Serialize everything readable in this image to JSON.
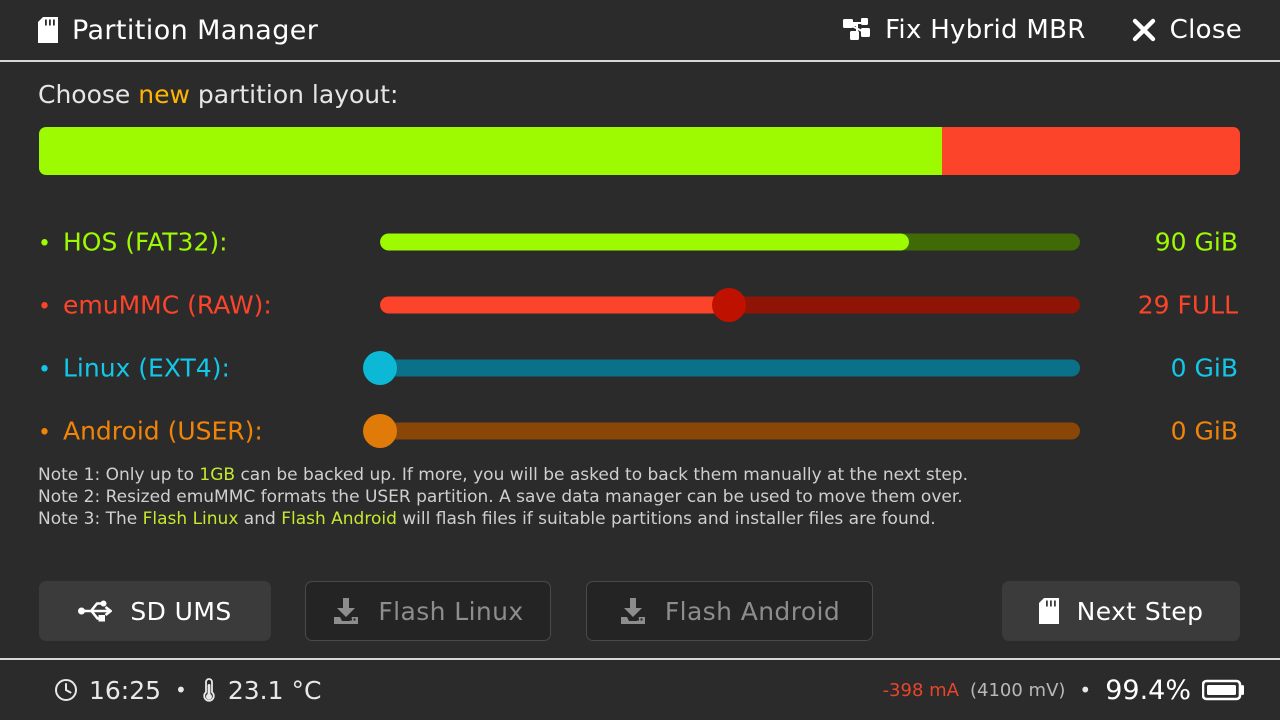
{
  "header": {
    "title": "Partition Manager",
    "title_icon": "sd-card-icon",
    "actions": [
      {
        "label": "Fix Hybrid MBR",
        "icon": "partition-tree-icon"
      },
      {
        "label": "Close",
        "icon": "close-x-icon"
      }
    ]
  },
  "prompt": {
    "prefix": "Choose ",
    "highlight": "new",
    "suffix": " partition layout:"
  },
  "layout_bar": {
    "segments": [
      {
        "name": "hos",
        "color": "#9dfa00",
        "percent": 75.2
      },
      {
        "name": "emummc",
        "color": "#fb4429",
        "percent": 24.8
      }
    ]
  },
  "partitions": [
    {
      "name": "hos",
      "label": "HOS (FAT32):",
      "value": "90 GiB",
      "color": "#9dfa00",
      "track_color": "#3f6a06",
      "fill_percent": 75.5,
      "knob": false,
      "knob_color": "#9dfa00"
    },
    {
      "name": "emummc",
      "label": "emuMMC (RAW):",
      "value": "29 FULL",
      "color": "#fb4429",
      "track_color": "#8f1405",
      "fill_percent": 49.8,
      "knob": true,
      "knob_color": "#bf1100"
    },
    {
      "name": "linux",
      "label": "Linux (EXT4):",
      "value": "0 GiB",
      "color": "#12c7e8",
      "track_color": "#0a7188",
      "fill_percent": 0,
      "knob": true,
      "knob_color": "#0cb8d6"
    },
    {
      "name": "android",
      "label": "Android (USER):",
      "value": "0 GiB",
      "color": "#f08409",
      "track_color": "#8a4606",
      "fill_percent": 0,
      "knob": true,
      "knob_color": "#e07b0a"
    }
  ],
  "notes": [
    {
      "parts": [
        {
          "t": "Note 1: Only up to ",
          "hl": false
        },
        {
          "t": "1GB",
          "hl": true
        },
        {
          "t": " can be backed up. If more, you will be asked to back them manually at the next step.",
          "hl": false
        }
      ]
    },
    {
      "parts": [
        {
          "t": "Note 2: Resized emuMMC formats the USER partition. A save data manager can be used to move them over.",
          "hl": false
        }
      ]
    },
    {
      "parts": [
        {
          "t": "Note 3: The ",
          "hl": false
        },
        {
          "t": "Flash Linux",
          "hl": true
        },
        {
          "t": " and ",
          "hl": false
        },
        {
          "t": "Flash Android",
          "hl": true
        },
        {
          "t": " will flash files if suitable partitions and installer files are found.",
          "hl": false
        }
      ]
    }
  ],
  "buttons": [
    {
      "name": "sd-ums",
      "label": "SD UMS",
      "icon": "usb-icon",
      "enabled": true
    },
    {
      "name": "flash-linux",
      "label": "Flash Linux",
      "icon": "download-install-icon",
      "enabled": false
    },
    {
      "name": "flash-android",
      "label": "Flash Android",
      "icon": "download-install-icon",
      "enabled": false
    },
    {
      "name": "next-step",
      "label": "Next Step",
      "icon": "sd-card-icon",
      "enabled": true
    }
  ],
  "status": {
    "clock_icon": "clock-icon",
    "time": "16:25",
    "separator": "•",
    "temp_icon": "thermometer-icon",
    "temperature": "23.1 °C",
    "current": "-398 mA",
    "voltage": "(4100 mV)",
    "battery_percent": "99.4%",
    "battery_icon": "battery-full-icon",
    "current_color": "#e8452b"
  }
}
